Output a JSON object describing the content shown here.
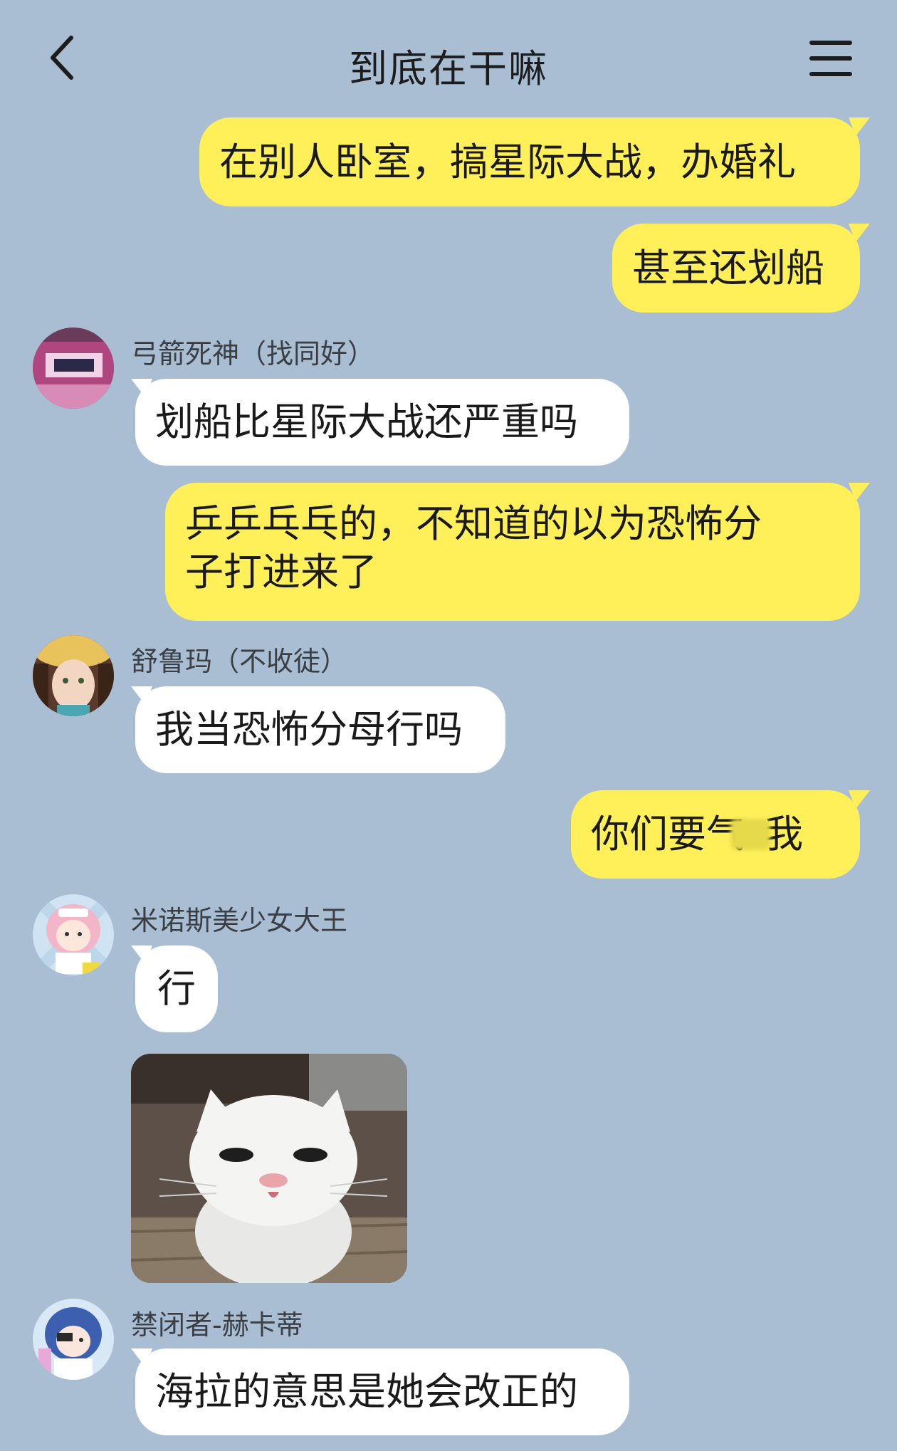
{
  "header": {
    "title": "到底在干嘛"
  },
  "messages": [
    {
      "side": "me",
      "text": "在别人卧室，搞星际大战，办婚礼"
    },
    {
      "side": "me",
      "text": "甚至还划船"
    },
    {
      "side": "them",
      "sender": "弓箭死神（找同好）",
      "text": "划船比星际大战还严重吗"
    },
    {
      "side": "me",
      "text_line1": "乒乒乓乓的，不知道的以为恐怖分",
      "text_line2": "子打进来了"
    },
    {
      "side": "them",
      "sender": "舒鲁玛（不收徒）",
      "text": "我当恐怖分母行吗"
    },
    {
      "side": "me",
      "text_before": "你们要气",
      "text_after": "我"
    },
    {
      "side": "them",
      "sender": "米诺斯美少女大王",
      "text": "行",
      "sticker": "white-cat-sticker"
    },
    {
      "side": "them",
      "sender": "禁闭者-赫卡蒂",
      "text": "海拉的意思是她会改正的"
    }
  ],
  "colors": {
    "background": "#a9bed3",
    "my_bubble": "#fff05a",
    "their_bubble": "#ffffff"
  }
}
